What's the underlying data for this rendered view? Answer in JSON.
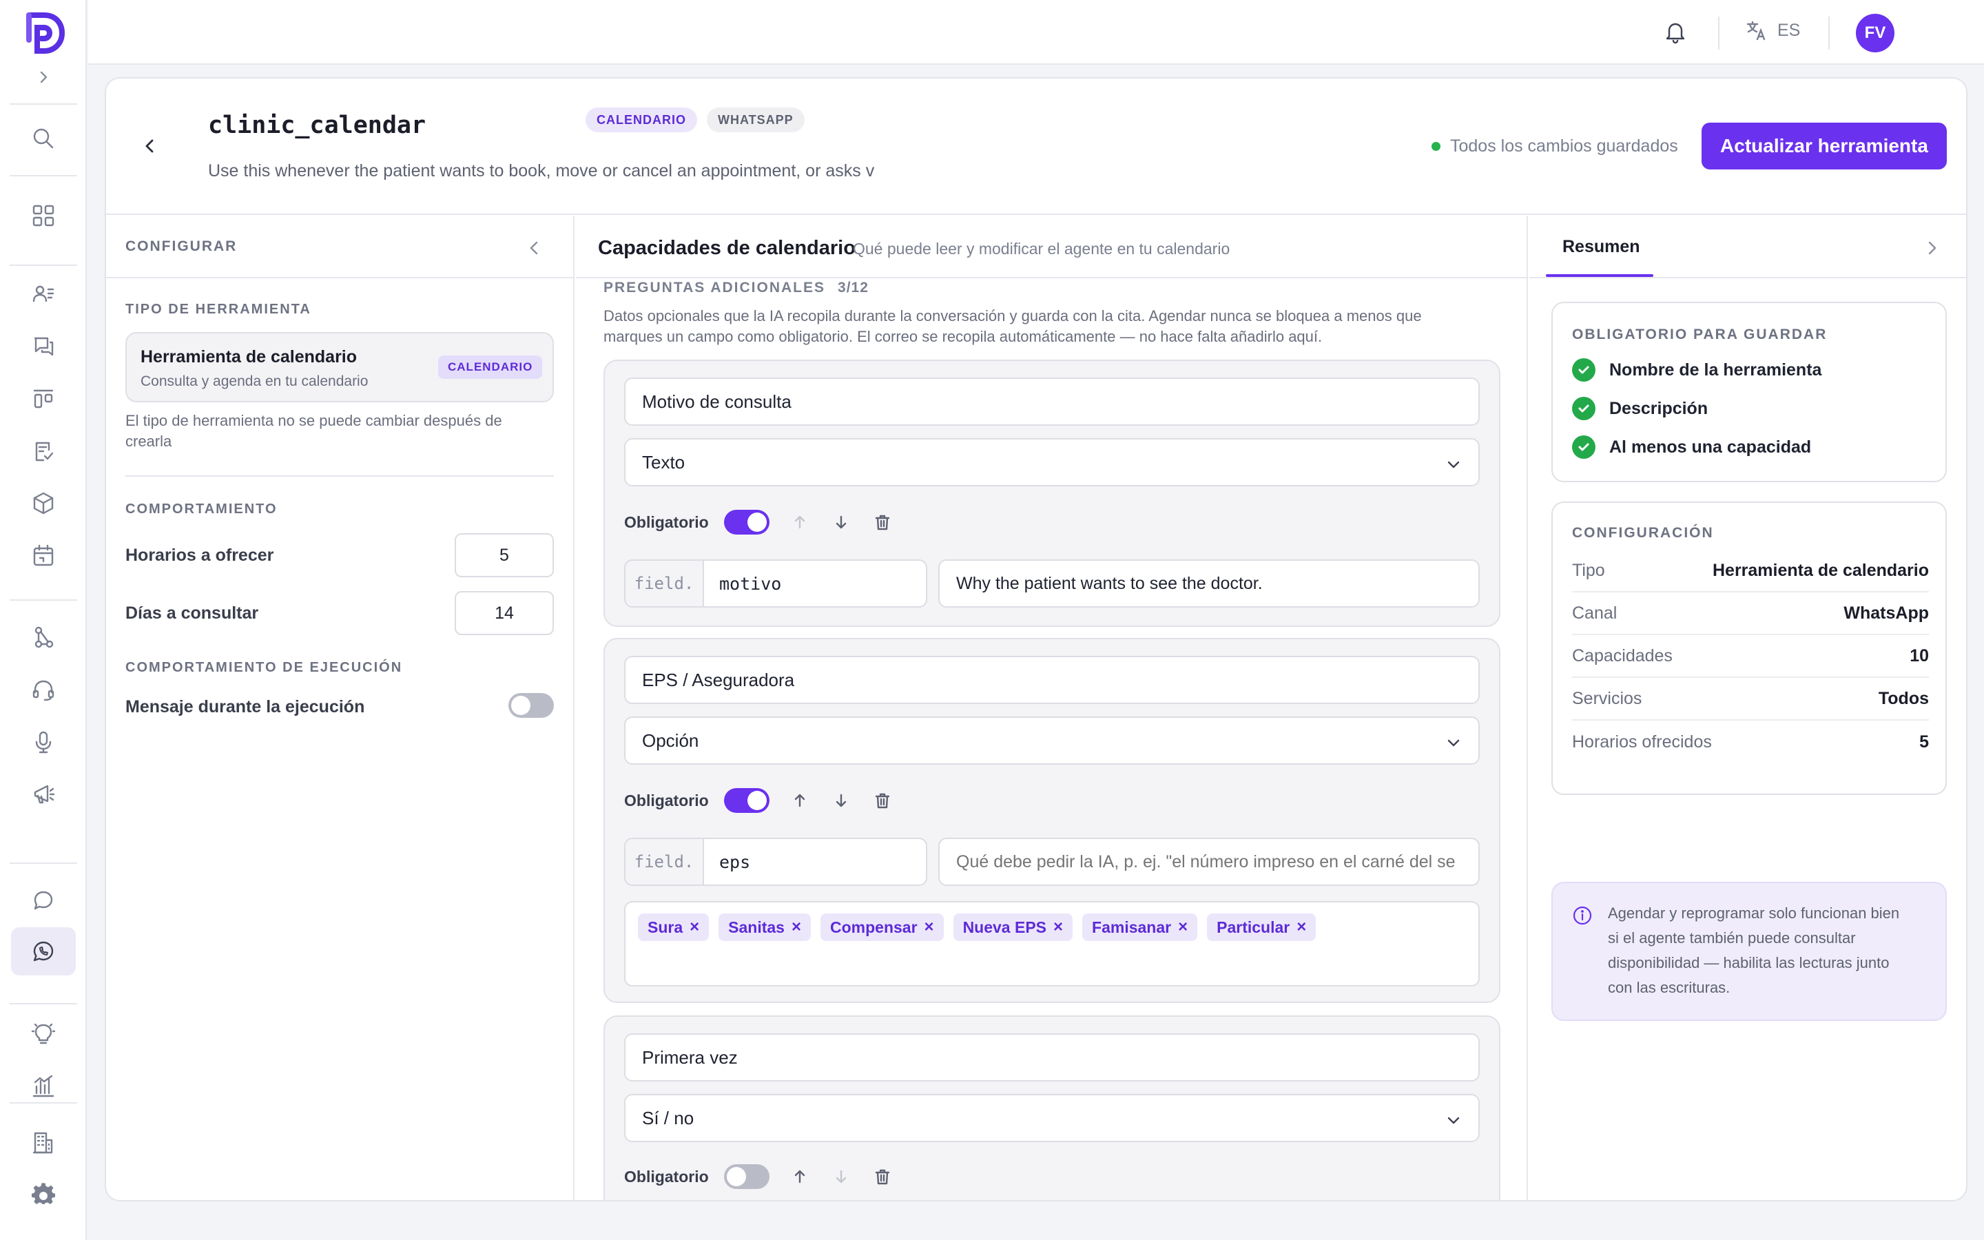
{
  "topbar": {
    "lang": "ES",
    "avatar_initials": "FV"
  },
  "tool": {
    "name": "clinic_calendar",
    "badges": [
      "CALENDARIO",
      "WHATSAPP"
    ],
    "description": "Use this whenever the patient wants to book, move or cancel an appointment, or asks v",
    "saved_status": "Todos los cambios guardados",
    "update_label": "Actualizar herramienta"
  },
  "configure": {
    "title": "CONFIGURAR",
    "type_caption": "TIPO DE HERRAMIENTA",
    "type_name": "Herramienta de calendario",
    "type_sub": "Consulta y agenda en tu calendario",
    "type_badge": "CALENDARIO",
    "type_note": "El tipo de herramienta no se puede cambiar después de crearla",
    "behavior_caption": "COMPORTAMIENTO",
    "slots_label": "Horarios a ofrecer",
    "slots_value": "5",
    "days_label": "Días a consultar",
    "days_value": "14",
    "exec_caption": "COMPORTAMIENTO DE EJECUCIÓN",
    "exec_label": "Mensaje durante la ejecución",
    "exec_enabled": false
  },
  "capabilities": {
    "title": "Capacidades de calendario",
    "subtitle": "Qué puede leer y modificar el agente en tu calendario",
    "section_caption": "PREGUNTAS ADICIONALES",
    "section_count": "3/12",
    "section_desc_1": "Datos opcionales que la IA recopila durante la conversación y guarda con la cita. Agendar nunca se bloquea a menos que",
    "section_desc_2": "marques un campo como obligatorio. El correo se recopila automáticamente — no hace falta añadirlo aquí.",
    "required_label": "Obligatorio",
    "key_prefix": "field.",
    "questions": [
      {
        "label": "Motivo de consulta",
        "type": "Texto",
        "required": true,
        "key": "motivo",
        "hint": "Why the patient wants to see the doctor."
      },
      {
        "label": "EPS / Aseguradora",
        "type": "Opción",
        "required": true,
        "key": "eps",
        "hint_placeholder": "Qué debe pedir la IA, p. ej. \"el número impreso en el carné del se",
        "options": [
          "Sura",
          "Sanitas",
          "Compensar",
          "Nueva EPS",
          "Famisanar",
          "Particular"
        ]
      },
      {
        "label": "Primera vez",
        "type": "Sí / no",
        "required": false
      }
    ]
  },
  "summary": {
    "tab": "Resumen",
    "required_caption": "OBLIGATORIO PARA GUARDAR",
    "required_items": [
      "Nombre de la herramienta",
      "Descripción",
      "Al menos una capacidad"
    ],
    "config_caption": "CONFIGURACIÓN",
    "config_rows": [
      {
        "k": "Tipo",
        "v": "Herramienta de calendario"
      },
      {
        "k": "Canal",
        "v": "WhatsApp"
      },
      {
        "k": "Capacidades",
        "v": "10"
      },
      {
        "k": "Servicios",
        "v": "Todos"
      },
      {
        "k": "Horarios ofrecidos",
        "v": "5"
      }
    ],
    "note": [
      "Agendar y reprogramar solo funcionan bien",
      "si el agente también puede consultar",
      "disponibilidad — habilita las lecturas junto",
      "con las escrituras."
    ]
  },
  "colors": {
    "accent": "#6a31ee",
    "success": "#27b34e"
  }
}
